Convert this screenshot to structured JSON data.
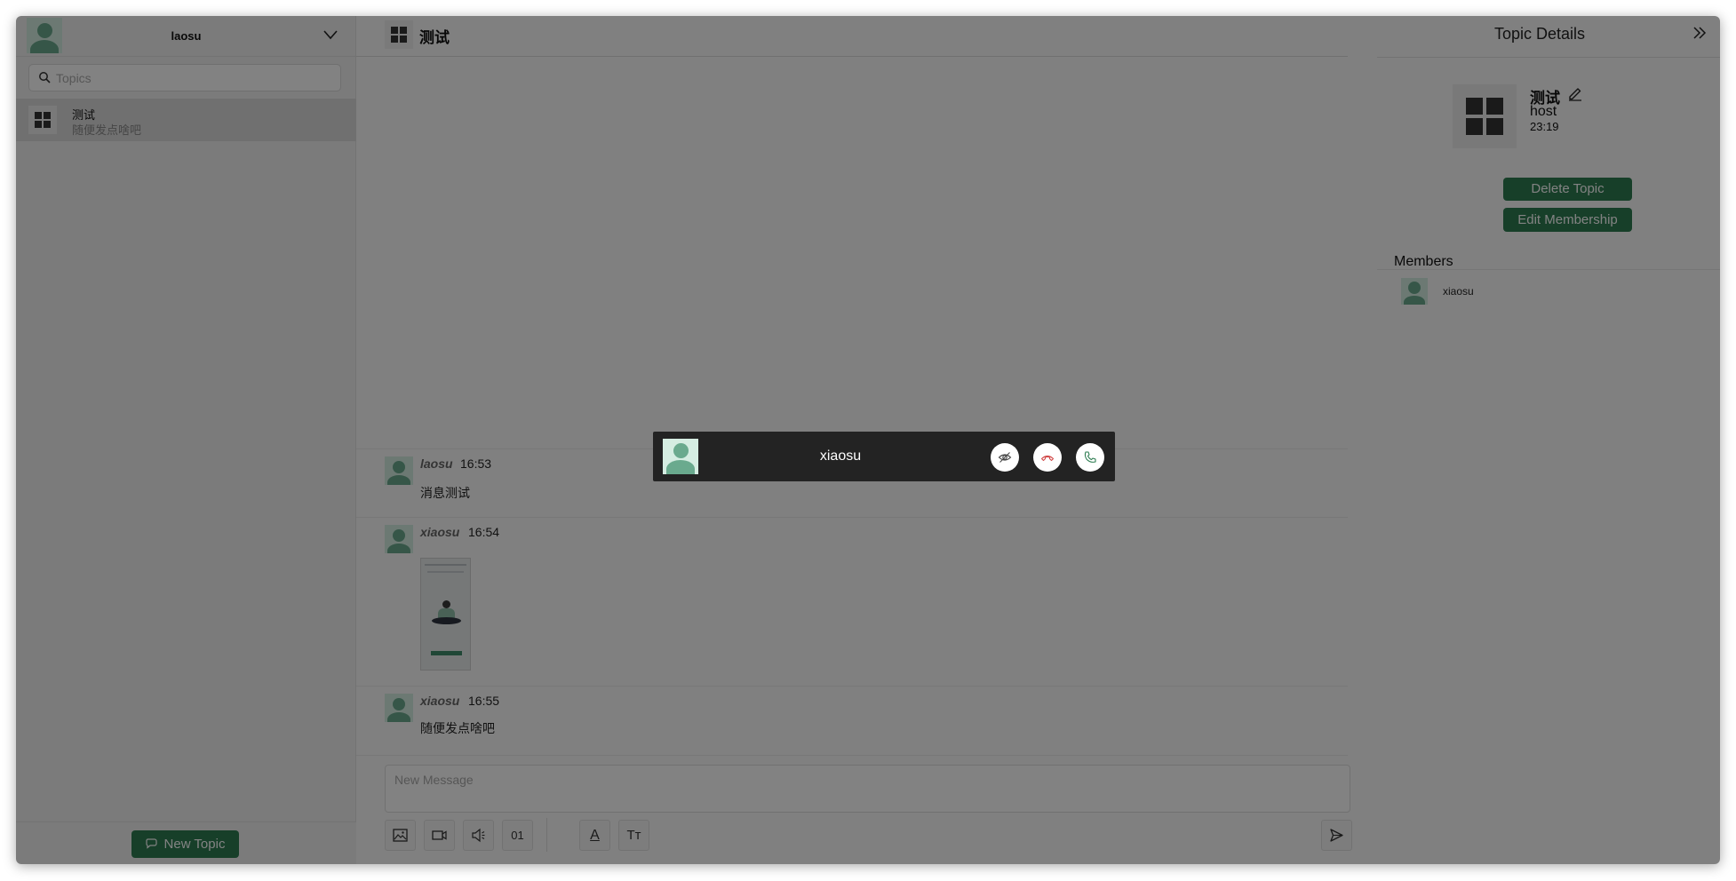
{
  "sidebar": {
    "username": "laosu",
    "search_placeholder": "Topics",
    "topics": [
      {
        "title": "测试",
        "subtitle": "随便发点啥吧"
      }
    ],
    "new_topic_label": "New Topic"
  },
  "chat": {
    "title": "测试",
    "messages": [
      {
        "author": "laosu",
        "time": "16:53",
        "text": "消息测试"
      },
      {
        "author": "xiaosu",
        "time": "16:54",
        "image": "image-attachment"
      },
      {
        "author": "xiaosu",
        "time": "16:55",
        "text": "随便发点啥吧"
      }
    ],
    "composer_placeholder": "New Message",
    "toolbar": {
      "image_icon": "image-icon",
      "video_icon": "video-icon",
      "audio_icon": "speaker-icon",
      "binary_label": "01",
      "text_format_label": "A",
      "text_size_label": "Tт",
      "send_icon": "send-icon"
    }
  },
  "details": {
    "title": "Topic Details",
    "topic_name": "测试",
    "role": "host",
    "time": "23:19",
    "delete_label": "Delete Topic",
    "edit_membership_label": "Edit Membership",
    "members_label": "Members",
    "members": [
      {
        "name": "xiaosu"
      }
    ]
  },
  "call": {
    "caller": "xiaosu",
    "buttons": [
      "hide-icon",
      "hang-up-icon",
      "answer-icon"
    ]
  },
  "colors": {
    "accent": "#2e7d52",
    "avatar": "#6aaa8e",
    "overlay": "rgba(0,0,0,0.49)"
  }
}
